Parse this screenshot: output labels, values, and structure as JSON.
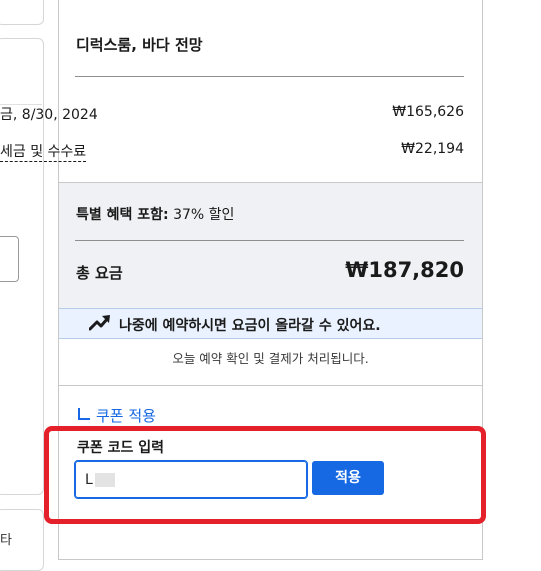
{
  "left_column": {
    "bottom_text": "타"
  },
  "summary": {
    "room_title": "디럭스룸, 바다 전망",
    "date_row": {
      "label": "금, 8/30, 2024",
      "value": "₩165,626"
    },
    "tax_row": {
      "label": "세금 및 수수료",
      "value": "₩22,194"
    },
    "special_offer": {
      "prefix": "특별 혜택 포함:",
      "text": " 37% 할인"
    },
    "total": {
      "label": "총 요금",
      "value": "₩187,820"
    }
  },
  "banner": {
    "icon": "trending-up-icon",
    "text": "나중에 예약하시면 요금이 올라갈 수 있어요."
  },
  "notice": "오늘 예약 확인 및 결제가 처리됩니다.",
  "coupon": {
    "link_label": "쿠폰 적용",
    "field_label": "쿠폰 코드 입력",
    "input_value": "L",
    "apply_label": "적용"
  },
  "colors": {
    "accent": "#1668e3",
    "highlight": "#e4202a",
    "banner_bg": "#e9f2fe",
    "section_bg": "#f0f1f4"
  }
}
